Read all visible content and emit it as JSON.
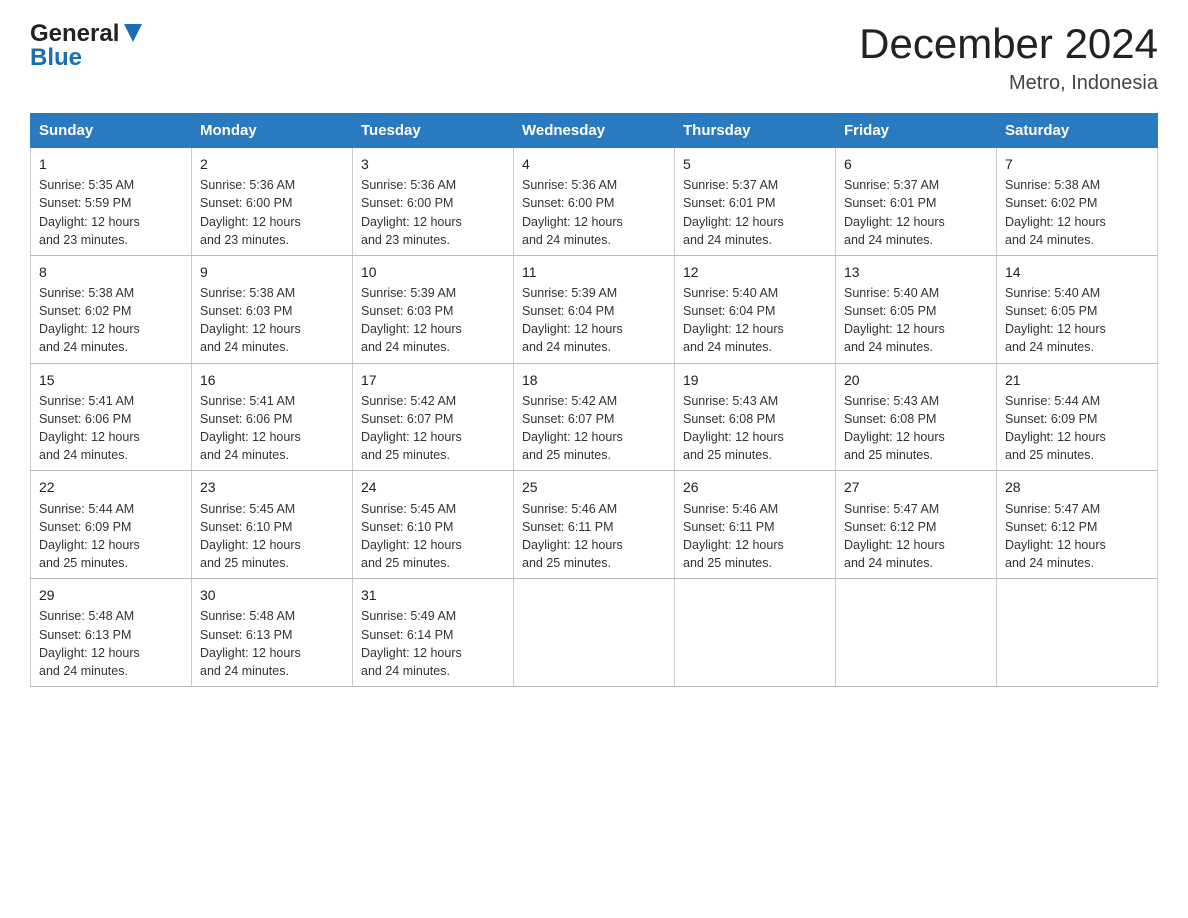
{
  "logo": {
    "general": "General",
    "blue": "Blue",
    "triangle": "▲"
  },
  "title": "December 2024",
  "subtitle": "Metro, Indonesia",
  "days_of_week": [
    "Sunday",
    "Monday",
    "Tuesday",
    "Wednesday",
    "Thursday",
    "Friday",
    "Saturday"
  ],
  "weeks": [
    [
      {
        "num": "1",
        "sunrise": "5:35 AM",
        "sunset": "5:59 PM",
        "daylight": "12 hours and 23 minutes."
      },
      {
        "num": "2",
        "sunrise": "5:36 AM",
        "sunset": "6:00 PM",
        "daylight": "12 hours and 23 minutes."
      },
      {
        "num": "3",
        "sunrise": "5:36 AM",
        "sunset": "6:00 PM",
        "daylight": "12 hours and 23 minutes."
      },
      {
        "num": "4",
        "sunrise": "5:36 AM",
        "sunset": "6:00 PM",
        "daylight": "12 hours and 24 minutes."
      },
      {
        "num": "5",
        "sunrise": "5:37 AM",
        "sunset": "6:01 PM",
        "daylight": "12 hours and 24 minutes."
      },
      {
        "num": "6",
        "sunrise": "5:37 AM",
        "sunset": "6:01 PM",
        "daylight": "12 hours and 24 minutes."
      },
      {
        "num": "7",
        "sunrise": "5:38 AM",
        "sunset": "6:02 PM",
        "daylight": "12 hours and 24 minutes."
      }
    ],
    [
      {
        "num": "8",
        "sunrise": "5:38 AM",
        "sunset": "6:02 PM",
        "daylight": "12 hours and 24 minutes."
      },
      {
        "num": "9",
        "sunrise": "5:38 AM",
        "sunset": "6:03 PM",
        "daylight": "12 hours and 24 minutes."
      },
      {
        "num": "10",
        "sunrise": "5:39 AM",
        "sunset": "6:03 PM",
        "daylight": "12 hours and 24 minutes."
      },
      {
        "num": "11",
        "sunrise": "5:39 AM",
        "sunset": "6:04 PM",
        "daylight": "12 hours and 24 minutes."
      },
      {
        "num": "12",
        "sunrise": "5:40 AM",
        "sunset": "6:04 PM",
        "daylight": "12 hours and 24 minutes."
      },
      {
        "num": "13",
        "sunrise": "5:40 AM",
        "sunset": "6:05 PM",
        "daylight": "12 hours and 24 minutes."
      },
      {
        "num": "14",
        "sunrise": "5:40 AM",
        "sunset": "6:05 PM",
        "daylight": "12 hours and 24 minutes."
      }
    ],
    [
      {
        "num": "15",
        "sunrise": "5:41 AM",
        "sunset": "6:06 PM",
        "daylight": "12 hours and 24 minutes."
      },
      {
        "num": "16",
        "sunrise": "5:41 AM",
        "sunset": "6:06 PM",
        "daylight": "12 hours and 24 minutes."
      },
      {
        "num": "17",
        "sunrise": "5:42 AM",
        "sunset": "6:07 PM",
        "daylight": "12 hours and 25 minutes."
      },
      {
        "num": "18",
        "sunrise": "5:42 AM",
        "sunset": "6:07 PM",
        "daylight": "12 hours and 25 minutes."
      },
      {
        "num": "19",
        "sunrise": "5:43 AM",
        "sunset": "6:08 PM",
        "daylight": "12 hours and 25 minutes."
      },
      {
        "num": "20",
        "sunrise": "5:43 AM",
        "sunset": "6:08 PM",
        "daylight": "12 hours and 25 minutes."
      },
      {
        "num": "21",
        "sunrise": "5:44 AM",
        "sunset": "6:09 PM",
        "daylight": "12 hours and 25 minutes."
      }
    ],
    [
      {
        "num": "22",
        "sunrise": "5:44 AM",
        "sunset": "6:09 PM",
        "daylight": "12 hours and 25 minutes."
      },
      {
        "num": "23",
        "sunrise": "5:45 AM",
        "sunset": "6:10 PM",
        "daylight": "12 hours and 25 minutes."
      },
      {
        "num": "24",
        "sunrise": "5:45 AM",
        "sunset": "6:10 PM",
        "daylight": "12 hours and 25 minutes."
      },
      {
        "num": "25",
        "sunrise": "5:46 AM",
        "sunset": "6:11 PM",
        "daylight": "12 hours and 25 minutes."
      },
      {
        "num": "26",
        "sunrise": "5:46 AM",
        "sunset": "6:11 PM",
        "daylight": "12 hours and 25 minutes."
      },
      {
        "num": "27",
        "sunrise": "5:47 AM",
        "sunset": "6:12 PM",
        "daylight": "12 hours and 24 minutes."
      },
      {
        "num": "28",
        "sunrise": "5:47 AM",
        "sunset": "6:12 PM",
        "daylight": "12 hours and 24 minutes."
      }
    ],
    [
      {
        "num": "29",
        "sunrise": "5:48 AM",
        "sunset": "6:13 PM",
        "daylight": "12 hours and 24 minutes."
      },
      {
        "num": "30",
        "sunrise": "5:48 AM",
        "sunset": "6:13 PM",
        "daylight": "12 hours and 24 minutes."
      },
      {
        "num": "31",
        "sunrise": "5:49 AM",
        "sunset": "6:14 PM",
        "daylight": "12 hours and 24 minutes."
      },
      null,
      null,
      null,
      null
    ]
  ],
  "labels": {
    "sunrise": "Sunrise:",
    "sunset": "Sunset:",
    "daylight": "Daylight:"
  }
}
